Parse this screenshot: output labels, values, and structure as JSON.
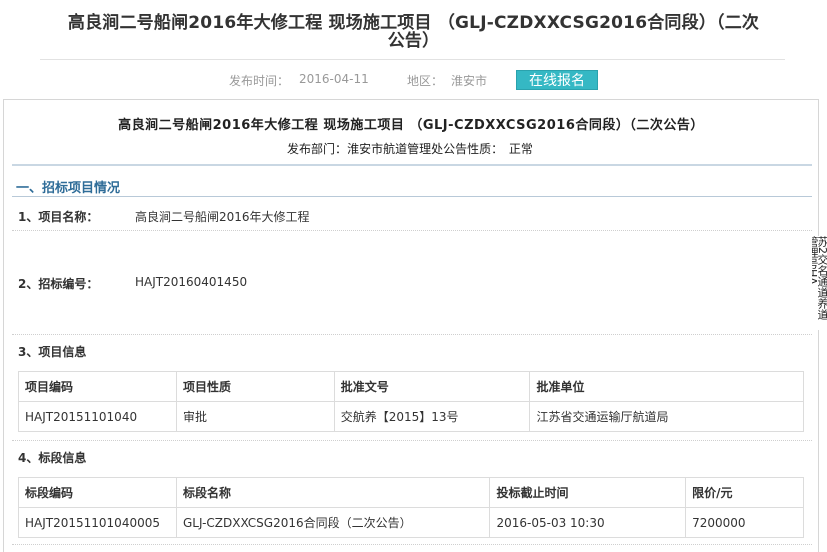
{
  "page": {
    "title_line1": "高良涧二号船闸2016年大修工程 现场施工项目 （GLJ-CZDXXCSG2016合同段）（二次",
    "title_line2": "公告）",
    "publish_label": "发布时间：",
    "publish_date": "2016-04-11",
    "region_label": "地区：",
    "region": "淮安市",
    "apply_button": "在线报名"
  },
  "panel": {
    "title": "高良涧二号船闸2016年大修工程 现场施工项目 （GLJ-CZDXXCSG2016合同段）（二次公告）",
    "dept_label": "发布部门：",
    "dept": "淮安市航道管理处",
    "nature_label": "公告性质：",
    "nature": "正常",
    "section1_title": "一、招标项目情况",
    "item1_label": "1、项目名称：",
    "item1_value": "高良涧二号船闸2016年大修工程",
    "item2_label": "2、招标编号：",
    "item2_value": "HAJT20160401450",
    "item3_label": "3、项目信息",
    "item4_label": "4、标段信息"
  },
  "project_table": {
    "headers": [
      "项目编码",
      "项目性质",
      "批准文号",
      "批准单位"
    ],
    "rows": [
      [
        "HAJT20151101040",
        "审批",
        "交航养【2015】13号",
        "江苏省交通运输厅航道局"
      ]
    ]
  },
  "section_table": {
    "headers": [
      "标段编码",
      "标段名称",
      "投标截止时间",
      "限价/元"
    ],
    "rows": [
      [
        "HAJT20151101040005",
        "GLJ-CZDXXCSG2016合同段（二次公告）",
        "2016-05-03 10:30",
        "7200000"
      ]
    ]
  },
  "side_strip_text": "苏2交名通道养道管理号HA"
}
